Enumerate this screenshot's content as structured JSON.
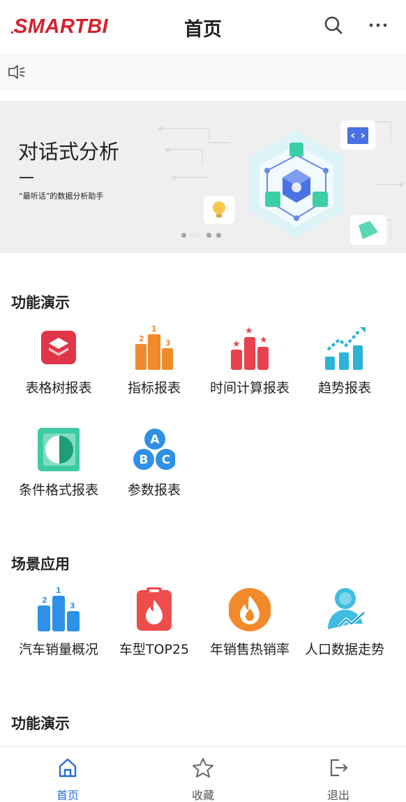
{
  "header": {
    "logo_text": "SMARTBI",
    "title": "首页",
    "search_icon": "search-icon",
    "more_icon": "more-icon"
  },
  "notice": {
    "icon": "speaker-icon"
  },
  "banner": {
    "title": "对话式分析",
    "subtitle": "“最听话”的数据分析助手",
    "slide_count": 4,
    "active_slide": 2
  },
  "sections": [
    {
      "title": "功能演示",
      "items": [
        {
          "label": "表格树报表",
          "icon": "layers-icon"
        },
        {
          "label": "指标报表",
          "icon": "podium-icon"
        },
        {
          "label": "时间计算报表",
          "icon": "bar-stars-icon"
        },
        {
          "label": "趋势报表",
          "icon": "trend-up-icon"
        },
        {
          "label": "条件格式报表",
          "icon": "half-circle-icon"
        },
        {
          "label": "参数报表",
          "icon": "abc-icon"
        }
      ]
    },
    {
      "title": "场景应用",
      "items": [
        {
          "label": "汽车销量概况",
          "icon": "podium-blue-icon"
        },
        {
          "label": "车型TOP25",
          "icon": "clipboard-fire-icon"
        },
        {
          "label": "年销售热销率",
          "icon": "fire-circle-icon"
        },
        {
          "label": "人口数据走势",
          "icon": "person-trend-icon"
        }
      ]
    },
    {
      "title": "功能演示"
    }
  ],
  "tabbar": [
    {
      "label": "首页",
      "icon": "home-icon",
      "active": true
    },
    {
      "label": "收藏",
      "icon": "star-icon",
      "active": false
    },
    {
      "label": "退出",
      "icon": "logout-icon",
      "active": false
    }
  ],
  "colors": {
    "brand": "#d4202a",
    "accent": "#2a6bd8"
  }
}
